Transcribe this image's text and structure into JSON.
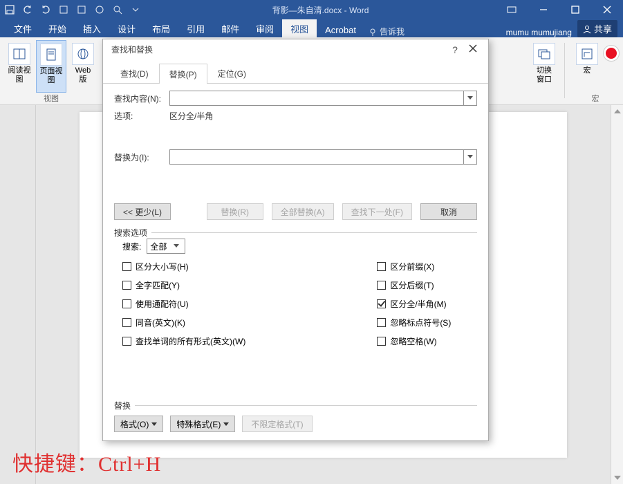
{
  "titlebar": {
    "document_title": "背影—朱自清.docx - Word"
  },
  "window_buttons": {
    "min": "–",
    "max": "□",
    "close": "✕"
  },
  "ribbon_tabs": {
    "items": [
      "文件",
      "开始",
      "插入",
      "设计",
      "布局",
      "引用",
      "邮件",
      "审阅",
      "视图",
      "Acrobat"
    ],
    "active_index": 8,
    "tell_me": "告诉我",
    "user": "mumu mumujiang",
    "share": "共享"
  },
  "ribbon": {
    "view_group_label": "视图",
    "btn_read": "阅读视图",
    "btn_page": "页面视图",
    "btn_web": "Web 版",
    "window_group": {
      "switch_windows": "切换窗口"
    },
    "macro_group": {
      "label": "宏",
      "macro": "宏"
    }
  },
  "dialog": {
    "title": "查找和替换",
    "help": "?",
    "close": "✕",
    "tabs": {
      "find": "查找(D)",
      "replace": "替换(P)",
      "goto": "定位(G)",
      "active": 1
    },
    "find_label": "查找内容(N):",
    "options_label": "选项:",
    "options_value": "区分全/半角",
    "replace_label": "替换为(I):",
    "find_value": "",
    "replace_value": "",
    "btn_less": "<< 更少(L)",
    "btn_replace": "替换(R)",
    "btn_replace_all": "全部替换(A)",
    "btn_find_next": "查找下一处(F)",
    "btn_cancel": "取消",
    "search_options_legend": "搜索选项",
    "search_label": "搜索:",
    "search_scope": "全部",
    "checks_left": [
      "区分大小写(H)",
      "全字匹配(Y)",
      "使用通配符(U)",
      "同音(英文)(K)",
      "查找单词的所有形式(英文)(W)"
    ],
    "checks_right": [
      "区分前缀(X)",
      "区分后缀(T)",
      "区分全/半角(M)",
      "忽略标点符号(S)",
      "忽略空格(W)"
    ],
    "replace_legend": "替换",
    "btn_format": "格式(O)",
    "btn_special": "特殊格式(E)",
    "btn_noformat": "不限定格式(T)"
  },
  "shortcut_text": "快捷键：Ctrl+H"
}
